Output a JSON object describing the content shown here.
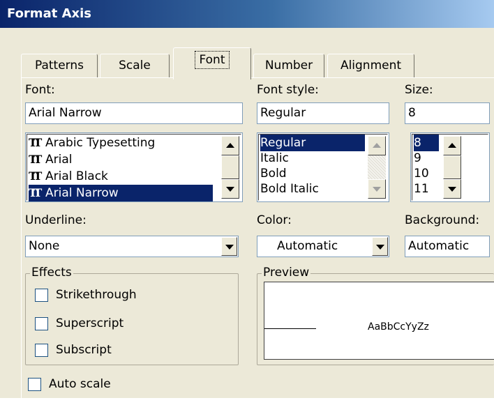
{
  "window": {
    "title": "Format Axis"
  },
  "tabs": [
    {
      "label": "Patterns"
    },
    {
      "label": "Scale"
    },
    {
      "label": "Font"
    },
    {
      "label": "Number"
    },
    {
      "label": "Alignment"
    }
  ],
  "active_tab": "Font",
  "font": {
    "label": "Font:",
    "value": "Arial Narrow",
    "list": [
      "Arabic Typesetting",
      "Arial",
      "Arial Black",
      "Arial Narrow"
    ],
    "selected": "Arial Narrow",
    "icon": "truetype-font-icon"
  },
  "font_style": {
    "label": "Font style:",
    "value": "Regular",
    "list": [
      "Regular",
      "Italic",
      "Bold",
      "Bold Italic"
    ],
    "selected": "Regular"
  },
  "size": {
    "label": "Size:",
    "value": "8",
    "list": [
      "8",
      "9",
      "10",
      "11"
    ],
    "selected": "8"
  },
  "underline": {
    "label": "Underline:",
    "value": "None"
  },
  "color": {
    "label": "Color:",
    "value": "Automatic"
  },
  "background": {
    "label": "Background:",
    "value": "Automatic"
  },
  "effects": {
    "legend": "Effects",
    "strikethrough": {
      "label": "Strikethrough",
      "checked": false
    },
    "superscript": {
      "label": "Superscript",
      "checked": false
    },
    "subscript": {
      "label": "Subscript",
      "checked": false
    }
  },
  "preview": {
    "legend": "Preview",
    "sample_text": "AaBbCcYyZz"
  },
  "auto_scale": {
    "label": "Auto scale",
    "checked": false
  },
  "colors": {
    "selection": "#0a246a",
    "dialog": "#ece9d8",
    "title_start": "#0a246a"
  }
}
